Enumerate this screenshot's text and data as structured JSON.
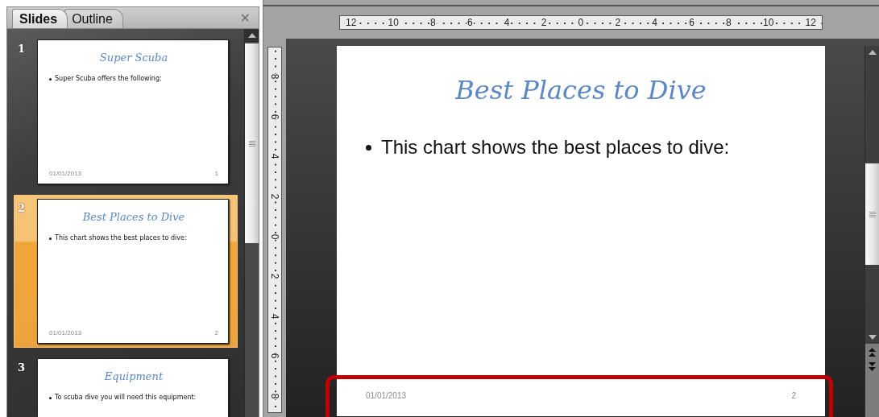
{
  "panel_tabs": [
    {
      "label": "Slides",
      "selected": true
    },
    {
      "label": "Outline",
      "selected": false
    }
  ],
  "close_glyph": "✕",
  "slides": [
    {
      "number": "1",
      "title": "Super Scuba",
      "bullet": "Super Scuba offers the following:",
      "footer_date": "01/01/2013",
      "footer_number": "1",
      "selected": false
    },
    {
      "number": "2",
      "title": "Best Places to Dive",
      "bullet": "This chart shows the best places to dive:",
      "footer_date": "01/01/2013",
      "footer_number": "2",
      "selected": true
    },
    {
      "number": "3",
      "title": "Equipment",
      "bullet": "To scuba dive you will need this equipment:",
      "selected": false
    }
  ],
  "horizontal_ruler": [
    "12",
    "10",
    "8",
    "6",
    "4",
    "2",
    "0",
    "2",
    "4",
    "6",
    "8",
    "10",
    "12"
  ],
  "vertical_ruler": [
    "8",
    "6",
    "4",
    "2",
    "0",
    "2",
    "4",
    "6",
    "8"
  ],
  "current_slide": {
    "title": "Best Places to Dive",
    "bullet": "This chart shows the best places to dive:",
    "footer_date": "01/01/2013",
    "footer_number": "2",
    "footer_highlighted": true
  }
}
